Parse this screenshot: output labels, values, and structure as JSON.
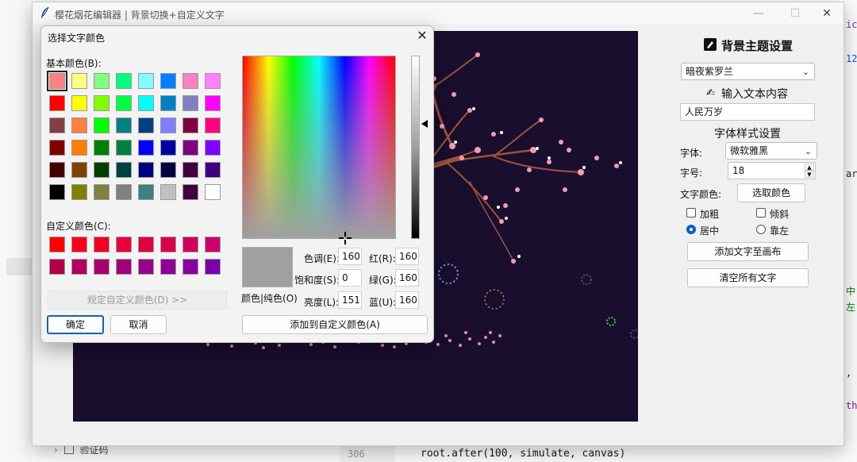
{
  "ide": {
    "line_number": "306",
    "code_line": "root.after(100, simulate, canvas)",
    "sidebar_item": "验证码",
    "right_snippets": [
      "ick",
      "12",
      "ar)",
      "中\"",
      "左\"",
      ",",
      "th="
    ]
  },
  "window": {
    "title": "樱花烟花编辑器 | 背景切换+自定义文字",
    "minimize": "—",
    "maximize": "☐",
    "close": "✕"
  },
  "panel": {
    "bg_heading": "背景主题设置",
    "bg_select_value": "暗夜紫罗兰",
    "text_heading": "输入文本内容",
    "text_value": "人民万岁",
    "style_heading": "字体样式设置",
    "font_label": "字体:",
    "font_value": "微软雅黑",
    "size_label": "字号:",
    "size_value": "18",
    "color_label": "文字颜色:",
    "color_button": "选取颜色",
    "bold_label": "加粗",
    "italic_label": "倾斜",
    "center_label": "居中",
    "left_label": "靠左",
    "add_button": "添加文字至画布",
    "clear_button": "清空所有文字"
  },
  "dialog": {
    "title": "选择文字颜色",
    "close": "✕",
    "basic_label": "基本颜色(B):",
    "custom_label": "自定义颜色(C):",
    "define_button": "规定自定义颜色(D) >>",
    "ok_button": "确定",
    "cancel_button": "取消",
    "add_custom_button": "添加到自定义颜色(A)",
    "preview_label": "颜色|纯色(O)",
    "hue_label": "色调(E):",
    "hue": "160",
    "sat_label": "饱和度(S):",
    "sat": "0",
    "lum_label": "亮度(L):",
    "lum": "151",
    "red_label": "红(R):",
    "red": "160",
    "green_label": "绿(G):",
    "green": "160",
    "blue_label": "蓝(U):",
    "blue": "160",
    "preview_color": "#a0a0a0",
    "basic_colors": [
      "#ff8080",
      "#ffff80",
      "#80ff80",
      "#00ff80",
      "#80ffff",
      "#0080ff",
      "#ff80c0",
      "#ff80ff",
      "#ff0000",
      "#ffff00",
      "#80ff00",
      "#00ff40",
      "#00ffff",
      "#0080c0",
      "#8080c0",
      "#ff00ff",
      "#804040",
      "#ff8040",
      "#00ff00",
      "#008080",
      "#004080",
      "#8080ff",
      "#800040",
      "#ff0080",
      "#800000",
      "#ff8000",
      "#008000",
      "#008040",
      "#0000ff",
      "#0000a0",
      "#800080",
      "#8000ff",
      "#400000",
      "#804000",
      "#004000",
      "#004040",
      "#000080",
      "#000040",
      "#400040",
      "#400080",
      "#000000",
      "#808000",
      "#808040",
      "#808080",
      "#408080",
      "#c0c0c0",
      "#400040",
      "#ffffff"
    ],
    "custom_colors": [
      "#ff0000",
      "#f8001a",
      "#f00022",
      "#e8003a",
      "#e00040",
      "#d8004e",
      "#d0005e",
      "#cc006c",
      "#b0004a",
      "#b00060",
      "#a80070",
      "#a0007c",
      "#98008a",
      "#900094",
      "#8800a0",
      "#7a00a8"
    ]
  }
}
